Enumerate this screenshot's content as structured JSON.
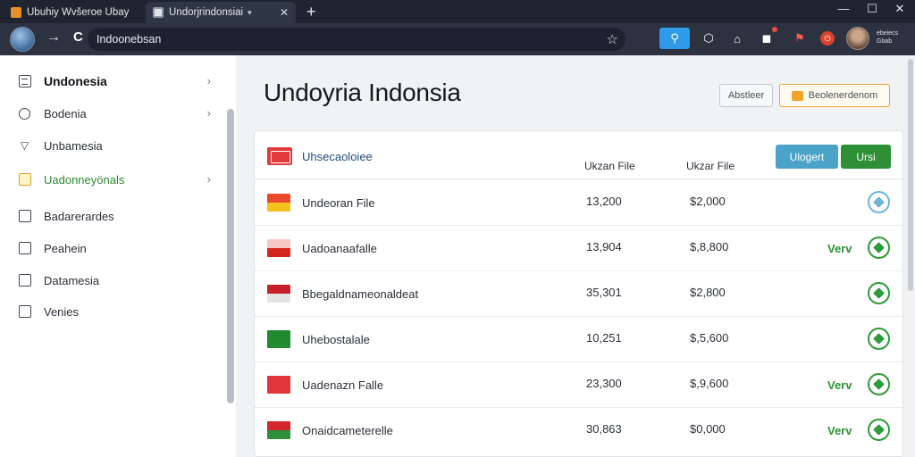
{
  "browser": {
    "tabs": [
      {
        "label": "Ubuhiy Wvšeroe Ubay",
        "active": false
      },
      {
        "label": "Undorjrindonsiai",
        "active": true
      }
    ],
    "url": "Indoonebsan",
    "menu_text": "ebeiecs Gbab"
  },
  "sidebar": {
    "items": [
      {
        "label": "Undonesia",
        "icon": "grid-box-icon",
        "chevron": true,
        "style": "bold"
      },
      {
        "label": "Bodenia",
        "icon": "search-circle-icon",
        "chevron": true,
        "style": "normal"
      },
      {
        "label": "Unbamesia",
        "icon": "chevron-v-icon",
        "chevron": false,
        "style": "normal"
      },
      {
        "label": "Uadonneyönals",
        "icon": "folder-yellow-icon",
        "chevron": true,
        "style": "green"
      },
      {
        "label": "Badarerardes",
        "icon": "box-icon",
        "chevron": false,
        "style": "normal"
      },
      {
        "label": "Peahein",
        "icon": "box-icon",
        "chevron": false,
        "style": "normal"
      },
      {
        "label": "Datamesia",
        "icon": "box-icon",
        "chevron": false,
        "style": "normal"
      },
      {
        "label": "Venies",
        "icon": "box-icon",
        "chevron": false,
        "style": "normal"
      }
    ]
  },
  "main": {
    "title": "Undoyria Indonsia",
    "btn_outline": "Abstleer",
    "btn_orange": "Beolenerdenom",
    "table": {
      "title": "Uhsecaoloiee",
      "col1": "Ukzan File",
      "col2": "Ukzar File",
      "btn_blue": "Ulogert",
      "btn_green": "Ursi",
      "rows": [
        {
          "name": "Undeoran File",
          "v1": "13,200",
          "v2": "$2,000",
          "status": "",
          "flag": "orange-yellow"
        },
        {
          "name": "Uadoanaafalle",
          "v1": "13,904",
          "v2": "$,8,800",
          "status": "Verv",
          "flag": "pink-red"
        },
        {
          "name": "Bbegaldnameonaldeat",
          "v1": "35,301",
          "v2": "$2,800",
          "status": "",
          "flag": "red-white"
        },
        {
          "name": "Uhebostalale",
          "v1": "10,251",
          "v2": "$,5,600",
          "status": "",
          "flag": "green"
        },
        {
          "name": "Uadenazn Falle",
          "v1": "23,300",
          "v2": "$,9,600",
          "status": "Verv",
          "flag": "red-emblem"
        },
        {
          "name": "Onaidcameterelle",
          "v1": "30,863",
          "v2": "$0,000",
          "status": "Verv",
          "flag": "red-green"
        }
      ]
    }
  },
  "colors": {
    "accent_blue": "#4ba3c9",
    "accent_green": "#2e8f36",
    "accent_orange": "#e3a33a",
    "chrome_dark": "#1f2430"
  }
}
